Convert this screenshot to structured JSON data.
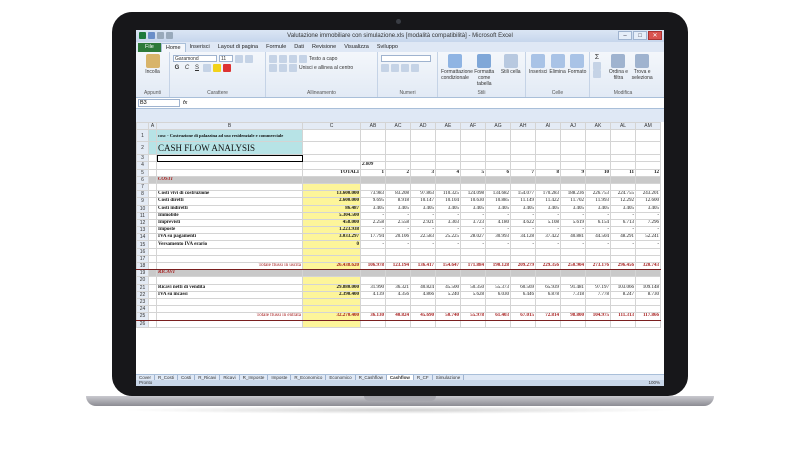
{
  "window": {
    "title": "Valutazione immobiliare con simulazione.xls [modalità compatibilità] - Microsoft Excel",
    "minimize": "–",
    "maximize": "□",
    "close": "✕"
  },
  "ribbon_tabs": [
    "File",
    "Home",
    "Inserisci",
    "Layout di pagina",
    "Formule",
    "Dati",
    "Revisione",
    "Visualizza",
    "Sviluppo"
  ],
  "ribbon": {
    "paste_label": "Incolla",
    "font_name": "Garamond",
    "font_size": "11",
    "wrap_text": "Testo a capo",
    "merge_center": "Unisci e allinea al centro",
    "number_format": "",
    "cond_format": "Formattazione condizionale",
    "format_table": "Formatta come tabella",
    "cell_styles": "Stili cella",
    "insert": "Inserisci",
    "delete": "Elimina",
    "format": "Formato",
    "sort_filter": "Ordina e filtra",
    "find_select": "Trova e seleziona",
    "groups": {
      "clipboard": "Appunti",
      "font": "Carattere",
      "alignment": "Allineamento",
      "number": "Numeri",
      "styles": "Stili",
      "cells": "Celle",
      "editing": "Modifica"
    }
  },
  "formula_bar": {
    "name_box": "B3",
    "fx": "fx",
    "content": ""
  },
  "columns": [
    "A",
    "B",
    "C",
    "AB",
    "AC",
    "AD",
    "AE",
    "AF",
    "AG",
    "AH",
    "AI",
    "AJ",
    "AK",
    "AL",
    "AM"
  ],
  "header_block": {
    "subtitle": "cosc - Costruzione di palazzina ad uso residenziale e commerciale",
    "title": "CASH FLOW ANALYSIS",
    "year": "2.009",
    "totals_label": "TOTALI",
    "periods": [
      "1",
      "2",
      "3",
      "4",
      "5",
      "6",
      "7",
      "8",
      "9",
      "10",
      "11",
      "12"
    ]
  },
  "rows": [
    {
      "n": "6",
      "label": "COSTI",
      "kind": "section"
    },
    {
      "n": "7",
      "label": "",
      "kind": "blank"
    },
    {
      "n": "8",
      "label": "Costi vivi di costruzione",
      "total": "13.600.000",
      "values": [
        "73.983",
        "83.208",
        "97.863",
        "110.325",
        "124.098",
        "134.682",
        "154.077",
        "170.283",
        "188.236",
        "226.753",
        "224.755",
        "243.201"
      ]
    },
    {
      "n": "9",
      "label": "Costi diretti",
      "total": "2.600.000",
      "values": [
        "9.695",
        "8.918",
        "10.147",
        "10.104",
        "10.630",
        "10.885",
        "11.149",
        "11.422",
        "11.702",
        "11.993",
        "12.292",
        "12.600"
      ]
    },
    {
      "n": "10",
      "label": "Costi indiretti",
      "total": "86.487",
      "values": [
        "3.405",
        "3.405",
        "3.405",
        "3.405",
        "3.405",
        "3.405",
        "3.405",
        "3.405",
        "3.405",
        "3.405",
        "3.405",
        "3.405"
      ]
    },
    {
      "n": "11",
      "label": "Immobile",
      "total": "5.304.500",
      "values": [
        "-",
        "-",
        "-",
        "-",
        "-",
        "-",
        "-",
        "-",
        "-",
        "-",
        "-",
        "-"
      ]
    },
    {
      "n": "12",
      "label": "Imprevisti",
      "total": "458.000",
      "values": [
        "2.258",
        "2.558",
        "2.921",
        "3.303",
        "3.723",
        "4.180",
        "4.622",
        "5.108",
        "5.619",
        "6.154",
        "6.713",
        "7.296"
      ]
    },
    {
      "n": "13",
      "label": "Imposte",
      "total": "1.223.938",
      "values": [
        "-",
        "-",
        "-",
        "-",
        "-",
        "-",
        "-",
        "-",
        "-",
        "-",
        "-",
        "-"
      ]
    },
    {
      "n": "14",
      "label": "IVA su pagamenti",
      "total": "3.033.297",
      "values": [
        "17.794",
        "20.106",
        "22.583",
        "25.225",
        "28.027",
        "30.993",
        "34.128",
        "37.422",
        "40.881",
        "44.504",
        "48.291",
        "52.241"
      ]
    },
    {
      "n": "15",
      "label": "Versamento IVA erario",
      "total": "0",
      "values": [
        "-",
        "-",
        "-",
        "-",
        "-",
        "-",
        "-",
        "-",
        "-",
        "-",
        "-",
        "-"
      ]
    },
    {
      "n": "16",
      "label": "",
      "kind": "blank"
    },
    {
      "n": "17",
      "label": "",
      "kind": "blank"
    },
    {
      "n": "18",
      "label": "Totale flussi in uscita",
      "total": "26.438.620",
      "values": [
        "106.978",
        "123.194",
        "136.417",
        "154.647",
        "171.884",
        "190.128",
        "209.279",
        "229.356",
        "250.904",
        "273.176",
        "296.456",
        "320.743"
      ],
      "kind": "total"
    },
    {
      "n": "19",
      "label": "RICAVI",
      "kind": "section"
    },
    {
      "n": "20",
      "label": "",
      "kind": "blank"
    },
    {
      "n": "21",
      "label": "Ricavi netti di vendita",
      "total": "29.880.000",
      "values": [
        "31.990",
        "36.321",
        "40.824",
        "45.500",
        "50.350",
        "55.373",
        "60.569",
        "65.939",
        "91.481",
        "97.197",
        "103.066",
        "109.148"
      ]
    },
    {
      "n": "22",
      "label": "IVA su incassi",
      "total": "2.390.400",
      "values": [
        "4.139",
        "4.356",
        "4.866",
        "5.240",
        "5.628",
        "6.030",
        "6.446",
        "6.878",
        "7.318",
        "7.778",
        "8.247",
        "8.730"
      ]
    },
    {
      "n": "23",
      "label": "",
      "kind": "blank"
    },
    {
      "n": "24",
      "label": "",
      "kind": "blank"
    },
    {
      "n": "25",
      "label": "Totale flussi in entrata",
      "total": "32.270.400",
      "values": [
        "36.130",
        "40.824",
        "45.690",
        "50.740",
        "55.978",
        "61.403",
        "67.015",
        "72.814",
        "98.800",
        "104.975",
        "111.313",
        "117.866"
      ],
      "kind": "total"
    },
    {
      "n": "26",
      "label": "",
      "kind": "blank"
    }
  ],
  "sheet_tabs": [
    "Cover",
    "R_Costi",
    "Costi",
    "R_Ricavi",
    "Ricavi",
    "R_Imposte",
    "Imposte",
    "R_Economico",
    "Economico",
    "R_Cashflow",
    "Cashflow",
    "R_CF",
    "Simulazione"
  ],
  "active_sheet": "Cashflow",
  "status": {
    "ready": "Pronto",
    "zoom": "100%"
  },
  "colors": {
    "file_tab": "#2d7a3a",
    "total_col": "#fdf59a",
    "title_bg": "#b7e3e6",
    "section_bg": "#c9c9c9",
    "section_text": "#a51a1a"
  }
}
